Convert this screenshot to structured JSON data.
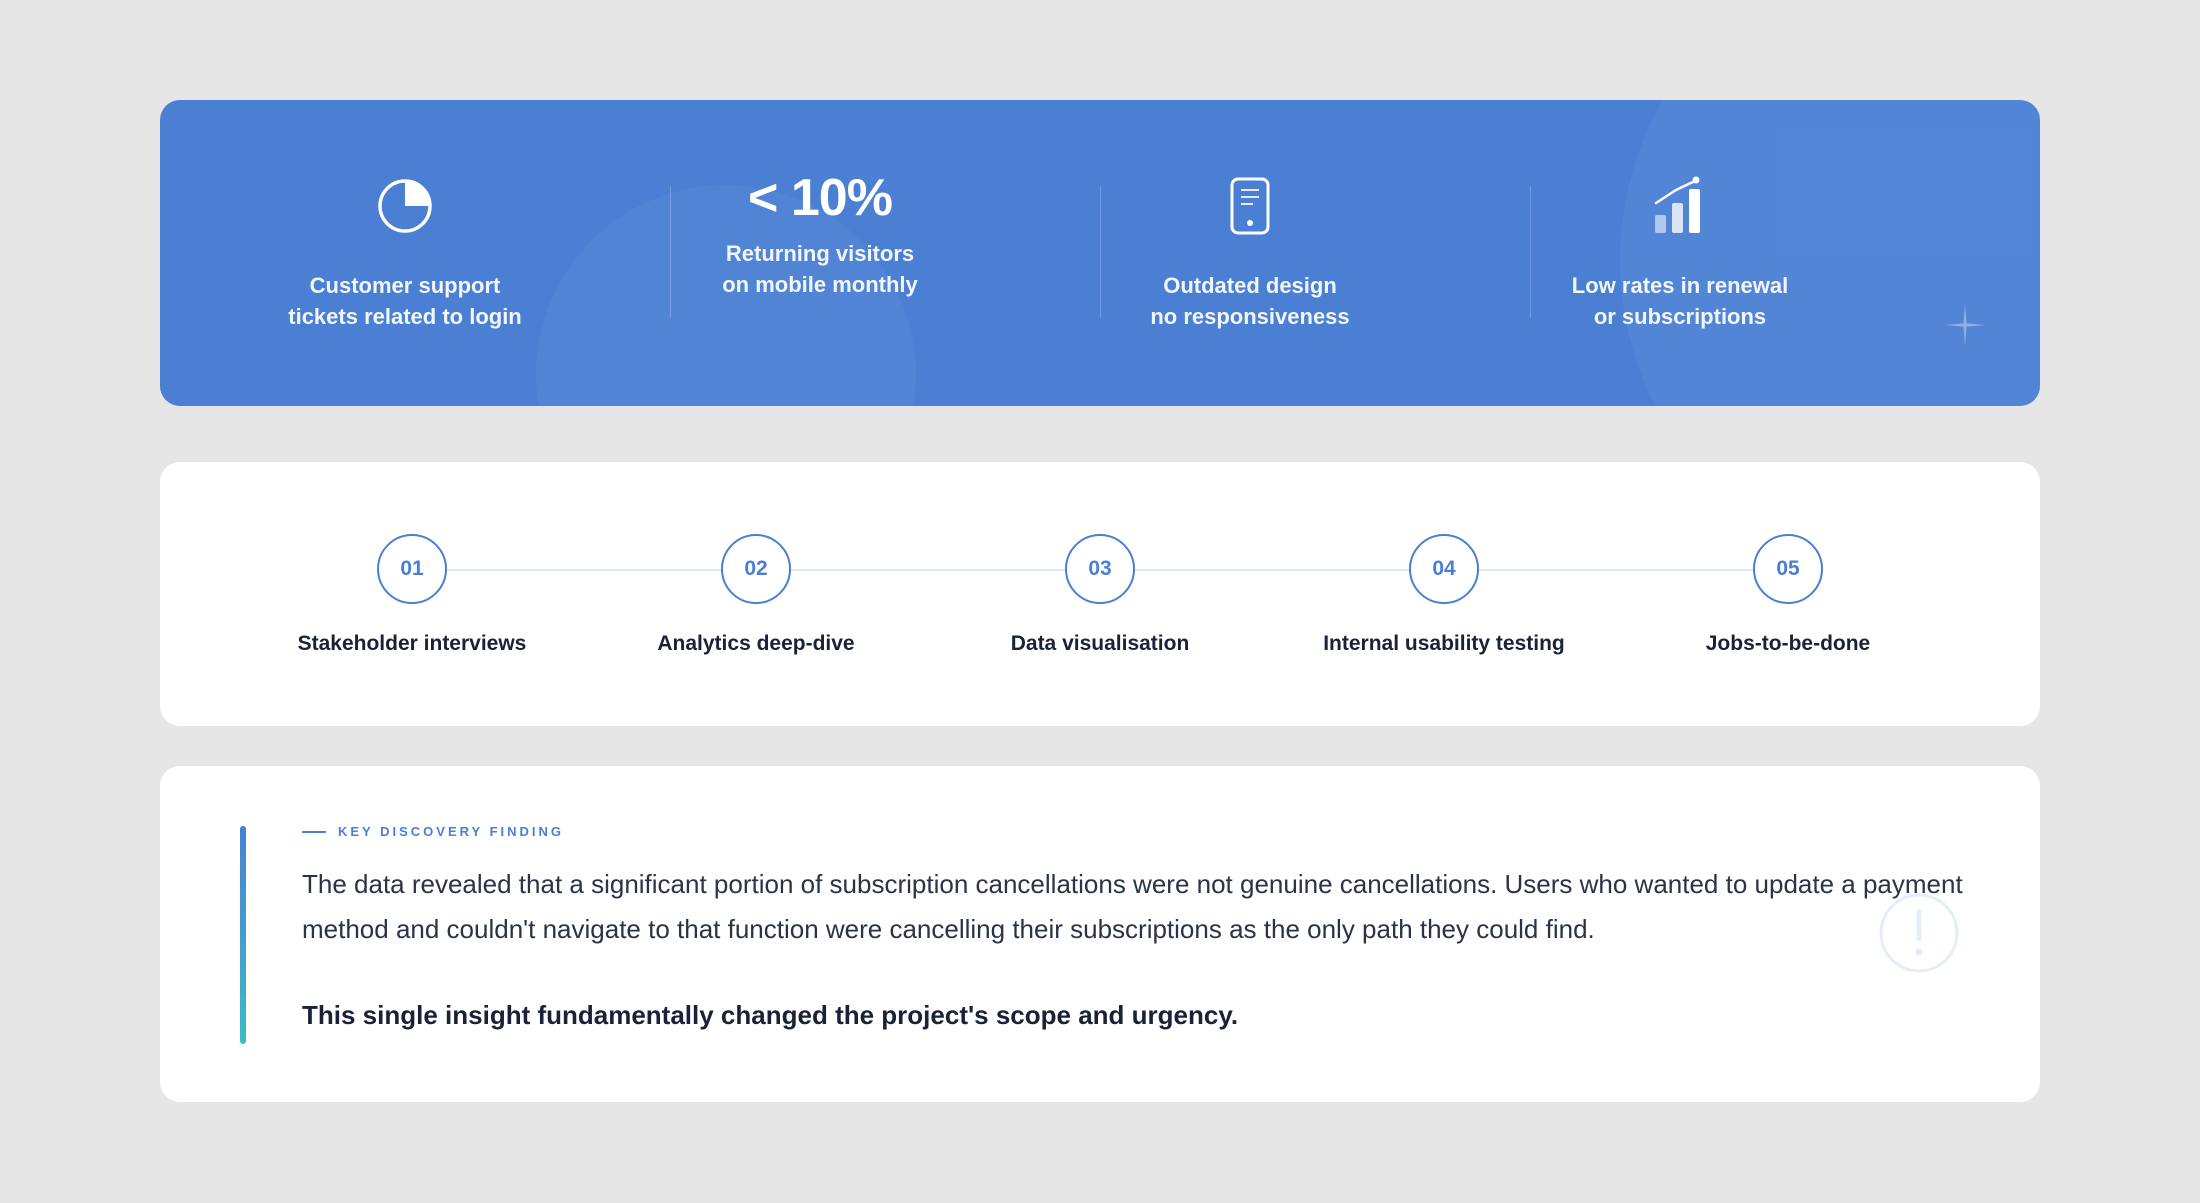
{
  "stats": [
    {
      "icon": "pie-chart-icon",
      "value": "",
      "label": "Customer support\ntickets related to login"
    },
    {
      "icon": "",
      "value": "< 10%",
      "label": "Returning visitors\non mobile monthly"
    },
    {
      "icon": "mobile-phone-icon",
      "value": "",
      "label": "Outdated design\nno responsiveness"
    },
    {
      "icon": "bar-chart-growth-icon",
      "value": "",
      "label": "Low rates in renewal\nor subscriptions"
    }
  ],
  "process": {
    "steps": [
      {
        "number": "01",
        "label": "Stakeholder interviews"
      },
      {
        "number": "02",
        "label": "Analytics deep-dive"
      },
      {
        "number": "03",
        "label": "Data visualisation"
      },
      {
        "number": "04",
        "label": "Internal usability testing"
      },
      {
        "number": "05",
        "label": "Jobs-to-be-done"
      }
    ]
  },
  "finding": {
    "eyebrow": "KEY DISCOVERY FINDING",
    "body": "The data revealed that a significant portion of subscription cancellations were not genuine cancellations. Users who wanted to update a payment method and couldn't navigate to that function were cancelling their subscriptions as the only path they could find.",
    "emphasis": "This single insight fundamentally changed the project's scope and urgency.",
    "icon": "exclamation-circle-icon"
  },
  "colors": {
    "page_background": "#e6e6e6",
    "banner_blue": "#4a7fd4",
    "accent_teal": "#3bbdc5",
    "text_dark": "#1a2238"
  }
}
